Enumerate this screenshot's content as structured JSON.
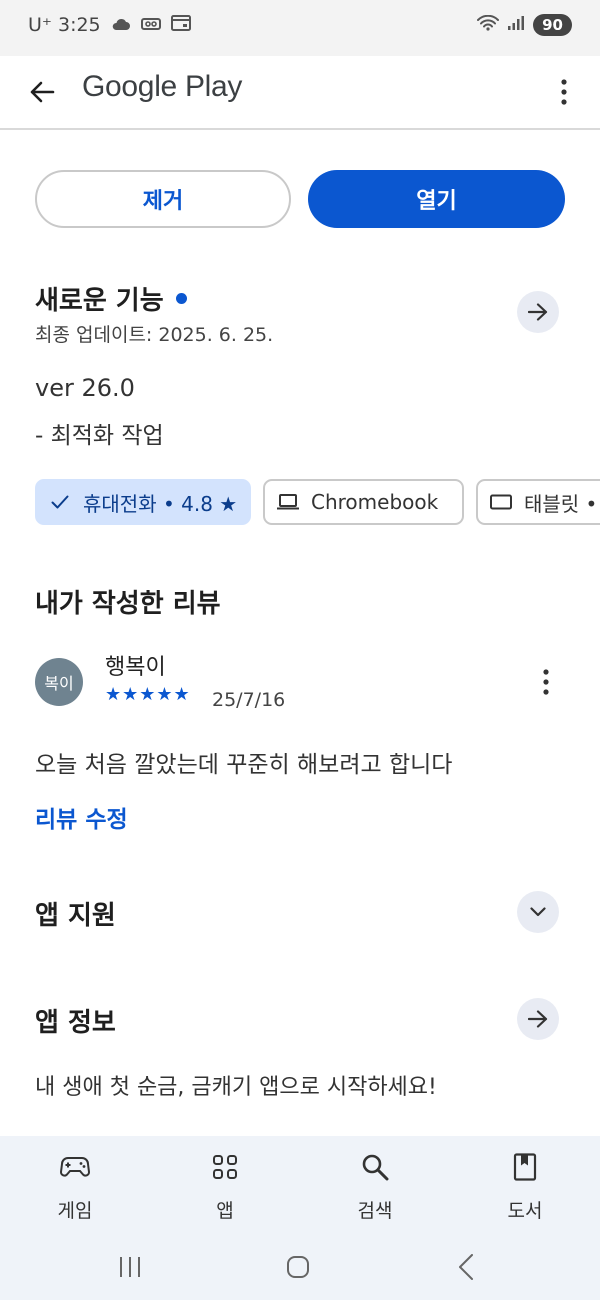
{
  "status_bar": {
    "carrier": "U⁺ 3:25",
    "battery": "90"
  },
  "app_bar": {
    "title": "Google Play"
  },
  "actions": {
    "remove_label": "제거",
    "open_label": "열기"
  },
  "whats_new": {
    "title": "새로운 기능",
    "updated": "최종 업데이트: 2025. 6. 25.",
    "version": "ver 26.0",
    "notes": "- 최적화 작업"
  },
  "device_chips": [
    {
      "label": "휴대전화 • 4.8 ★",
      "selected": true,
      "icon": "check-icon"
    },
    {
      "label": "Chromebook",
      "selected": false,
      "icon": "laptop-icon"
    },
    {
      "label": "태블릿 •",
      "selected": false,
      "icon": "tablet-icon"
    }
  ],
  "my_review": {
    "title": "내가 작성한 리뷰",
    "avatar_text": "복이",
    "reviewer": "행복이",
    "stars": "★★★★★",
    "rating": 5,
    "date": "25/7/16",
    "text": "오늘 처음 깔았는데 꾸준히 해보려고 합니다",
    "edit_label": "리뷰 수정"
  },
  "app_support": {
    "title": "앱 지원"
  },
  "about": {
    "title": "앱 정보",
    "description": "내 생애 첫 순금, 금캐기 앱으로 시작하세요!"
  },
  "bottom_nav": [
    {
      "label": "게임",
      "icon": "gamepad-icon"
    },
    {
      "label": "앱",
      "icon": "apps-grid-icon"
    },
    {
      "label": "검색",
      "icon": "search-icon"
    },
    {
      "label": "도서",
      "icon": "book-icon"
    }
  ],
  "colors": {
    "accent": "#0b57d0",
    "chip_selected_bg": "#d3e3fd",
    "round_button_bg": "#e8ebf3",
    "nav_bg": "#eff3f9"
  }
}
